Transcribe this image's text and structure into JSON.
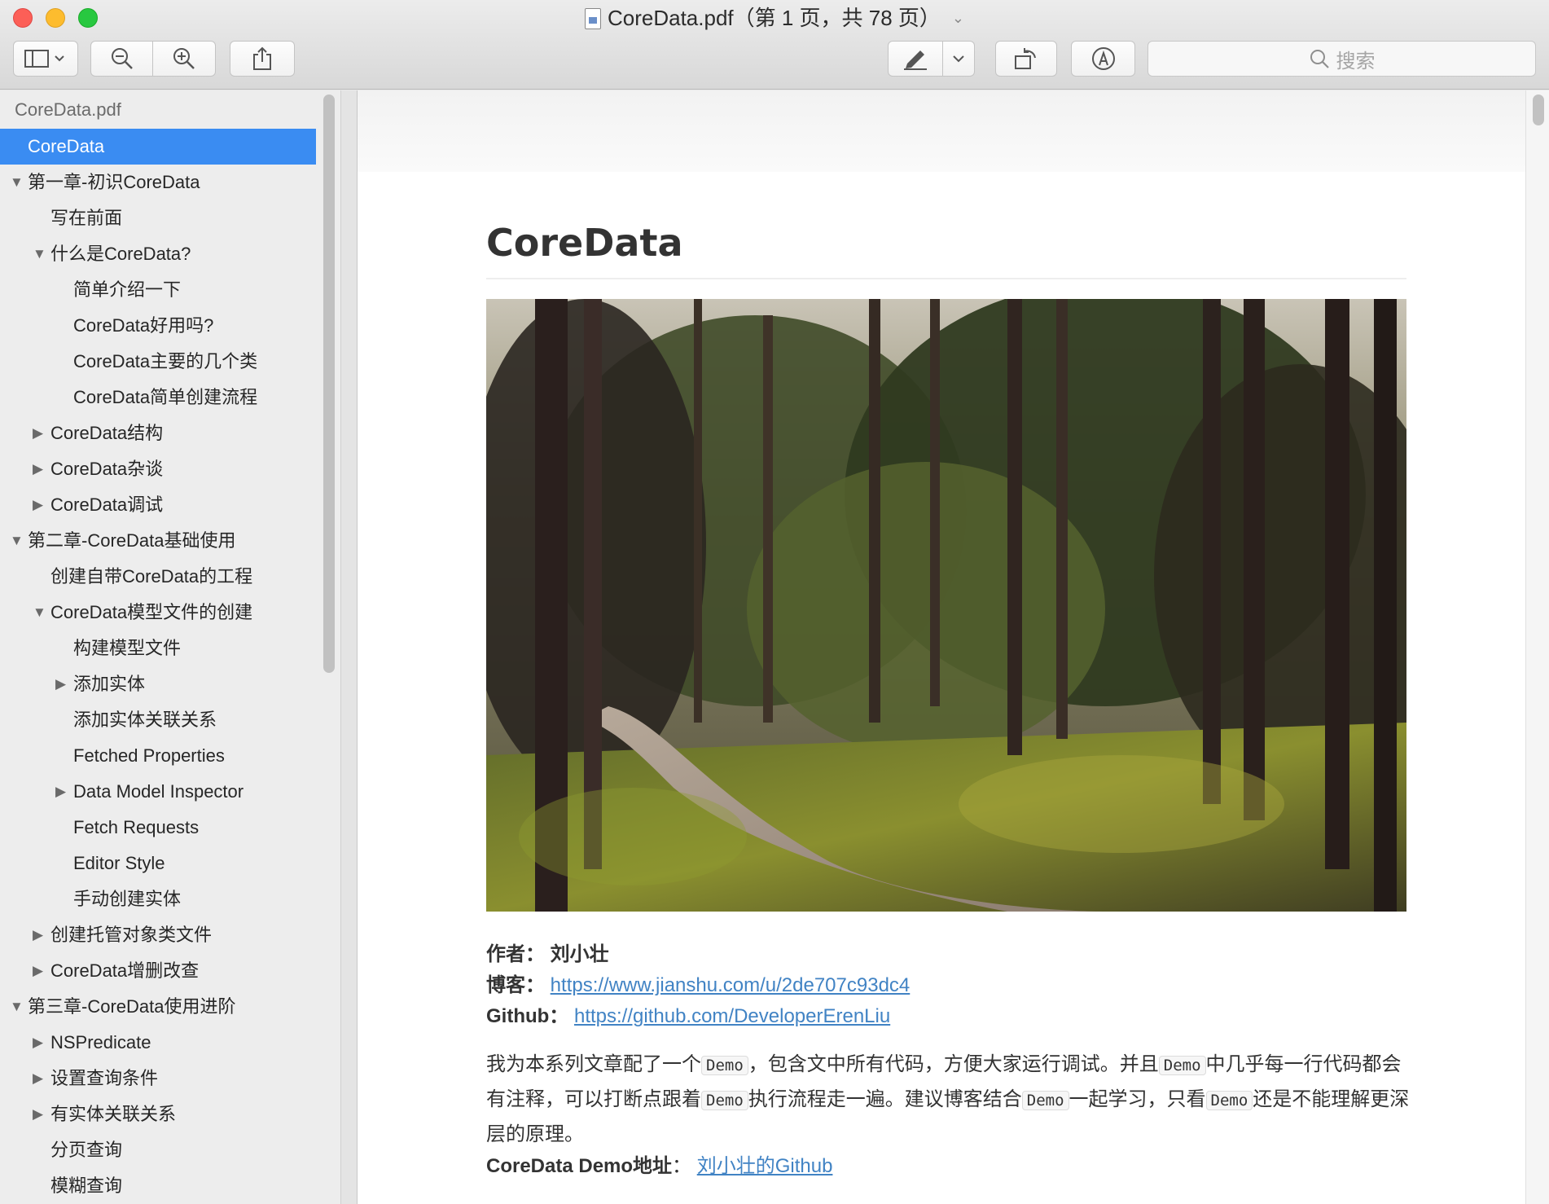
{
  "window": {
    "title": "CoreData.pdf（第 1 页，共 78 页）"
  },
  "toolbar": {
    "search_placeholder": "搜索"
  },
  "sidebar": {
    "file_name": "CoreData.pdf",
    "items": [
      {
        "label": "CoreData",
        "level": 0,
        "toggle": "none",
        "selected": true
      },
      {
        "label": "第一章-初识CoreData",
        "level": 0,
        "toggle": "expanded"
      },
      {
        "label": "写在前面",
        "level": 1,
        "toggle": "none"
      },
      {
        "label": "什么是CoreData?",
        "level": 1,
        "toggle": "expanded"
      },
      {
        "label": "简单介绍一下",
        "level": 2,
        "toggle": "none"
      },
      {
        "label": "CoreData好用吗?",
        "level": 2,
        "toggle": "none"
      },
      {
        "label": "CoreData主要的几个类",
        "level": 2,
        "toggle": "none"
      },
      {
        "label": "CoreData简单创建流程",
        "level": 2,
        "toggle": "none"
      },
      {
        "label": "CoreData结构",
        "level": 1,
        "toggle": "collapsed"
      },
      {
        "label": "CoreData杂谈",
        "level": 1,
        "toggle": "collapsed"
      },
      {
        "label": "CoreData调试",
        "level": 1,
        "toggle": "collapsed"
      },
      {
        "label": "第二章-CoreData基础使用",
        "level": 0,
        "toggle": "expanded"
      },
      {
        "label": "创建自带CoreData的工程",
        "level": 1,
        "toggle": "none"
      },
      {
        "label": "CoreData模型文件的创建",
        "level": 1,
        "toggle": "expanded"
      },
      {
        "label": "构建模型文件",
        "level": 2,
        "toggle": "none"
      },
      {
        "label": "添加实体",
        "level": 2,
        "toggle": "collapsed"
      },
      {
        "label": "添加实体关联关系",
        "level": 2,
        "toggle": "none"
      },
      {
        "label": "Fetched Properties",
        "level": 2,
        "toggle": "none"
      },
      {
        "label": "Data Model Inspector",
        "level": 2,
        "toggle": "collapsed"
      },
      {
        "label": "Fetch Requests",
        "level": 2,
        "toggle": "none"
      },
      {
        "label": "Editor Style",
        "level": 2,
        "toggle": "none"
      },
      {
        "label": "手动创建实体",
        "level": 2,
        "toggle": "none"
      },
      {
        "label": "创建托管对象类文件",
        "level": 1,
        "toggle": "collapsed"
      },
      {
        "label": "CoreData增删改查",
        "level": 1,
        "toggle": "collapsed"
      },
      {
        "label": "第三章-CoreData使用进阶",
        "level": 0,
        "toggle": "expanded"
      },
      {
        "label": "NSPredicate",
        "level": 1,
        "toggle": "collapsed"
      },
      {
        "label": "设置查询条件",
        "level": 1,
        "toggle": "collapsed"
      },
      {
        "label": "有实体关联关系",
        "level": 1,
        "toggle": "collapsed"
      },
      {
        "label": "分页查询",
        "level": 1,
        "toggle": "none"
      },
      {
        "label": "模糊查询",
        "level": 1,
        "toggle": "none"
      }
    ]
  },
  "document": {
    "heading": "CoreData",
    "author_label": "作者：",
    "author_name": "刘小壮",
    "blog_label": "博客：",
    "blog_url": "https://www.jianshu.com/u/2de707c93dc4",
    "github_label": "Github：",
    "github_url": "https://github.com/DeveloperErenLiu",
    "para_1": "我为本系列文章配了一个",
    "code": "Demo",
    "para_2": "，包含文中所有代码，方便大家运行调试。并且",
    "para_3": "中几乎每一行代码都会有注释，可以打断点跟着",
    "para_4": "执行流程走一遍。建议博客结合",
    "para_5": "一起学习，只看",
    "para_6": "还是不能理解更深层的原理。",
    "demo_label": "CoreData Demo地址",
    "demo_colon": "：",
    "demo_link": "刘小壮的Github"
  }
}
